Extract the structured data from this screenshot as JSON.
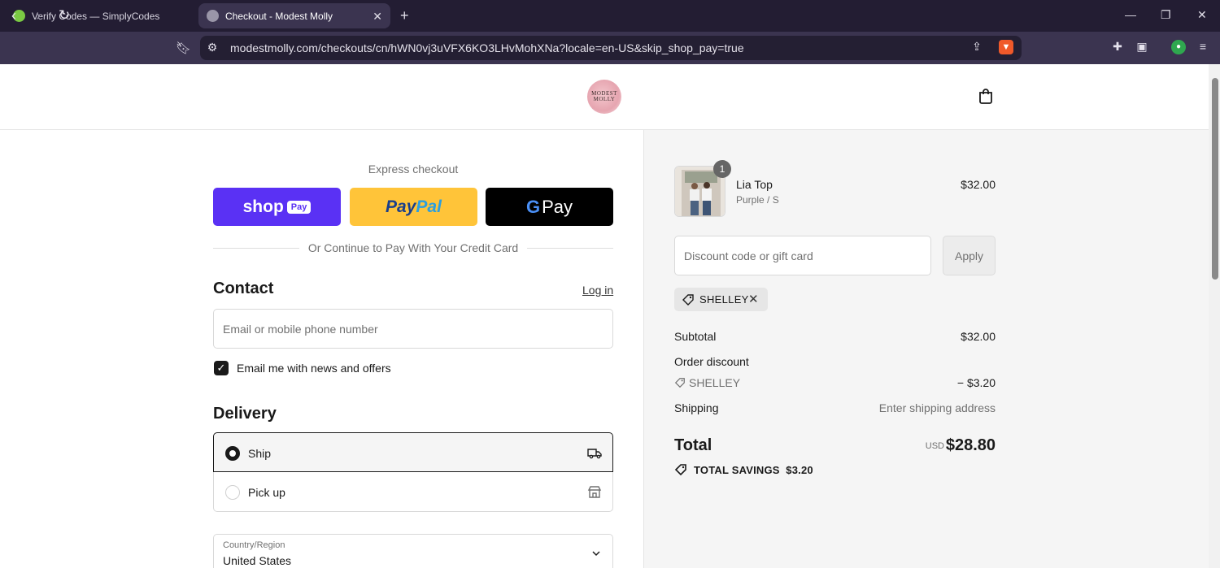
{
  "browser": {
    "tabs": [
      {
        "title": "Verify Codes — SimplyCodes"
      },
      {
        "title": "Checkout - Modest Molly"
      }
    ],
    "url": "modestmolly.com/checkouts/cn/hWN0vj3uVFX6KO3LHvMohXNa?locale=en-US&skip_shop_pay=true"
  },
  "store": {
    "logo_text": "MODEST MOLLY"
  },
  "express": {
    "label": "Express checkout",
    "shop_pay": {
      "word": "shop",
      "badge": "Pay"
    },
    "paypal": {
      "part1": "Pay",
      "part2": "Pal"
    },
    "gpay": {
      "g": "G",
      "word": "Pay"
    },
    "divider": "Or Continue to Pay With Your Credit Card"
  },
  "contact": {
    "heading": "Contact",
    "login": "Log in",
    "email_placeholder": "Email or mobile phone number",
    "newsletter_label": "Email me with news and offers",
    "newsletter_checked": true
  },
  "delivery": {
    "heading": "Delivery",
    "options": [
      {
        "label": "Ship",
        "selected": true
      },
      {
        "label": "Pick up",
        "selected": false
      }
    ],
    "country_label": "Country/Region",
    "country_value": "United States"
  },
  "summary": {
    "item": {
      "quantity": "1",
      "name": "Lia Top",
      "variant": "Purple / S",
      "price": "$32.00"
    },
    "discount_placeholder": "Discount code or gift card",
    "apply_label": "Apply",
    "applied_code": "SHELLEY",
    "subtotal_label": "Subtotal",
    "subtotal_value": "$32.00",
    "order_discount_label": "Order discount",
    "discount_code": "SHELLEY",
    "discount_value": "− $3.20",
    "shipping_label": "Shipping",
    "shipping_value": "Enter shipping address",
    "total_label": "Total",
    "currency": "USD",
    "total_value": "$28.80",
    "savings_label": "TOTAL SAVINGS",
    "savings_value": "$3.20"
  },
  "colors": {
    "shop_pay": "#5a31f4",
    "paypal": "#ffc439",
    "gpay": "#000000",
    "sidebar_bg": "#f5f5f5"
  }
}
